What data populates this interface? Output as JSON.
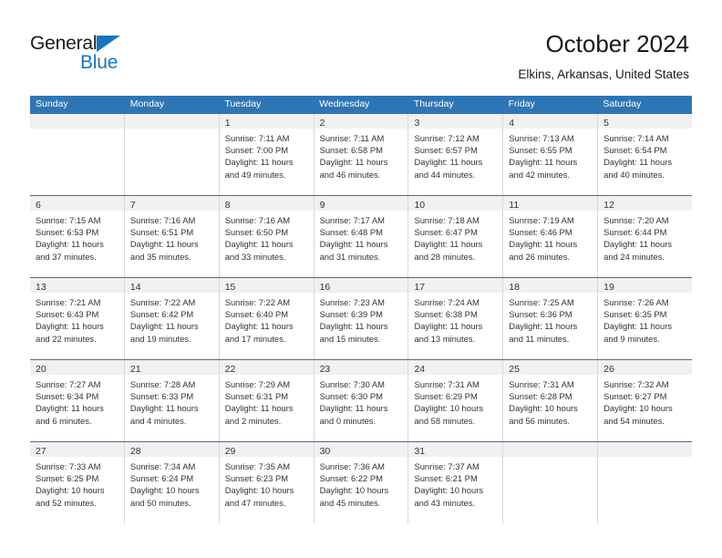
{
  "logo": {
    "word_one": "General",
    "word_two": "Blue",
    "triangle_color": "#1b75bb",
    "text_color": "#1a1a1a"
  },
  "header": {
    "title": "October 2024",
    "location": "Elkins, Arkansas, United States"
  },
  "theme": {
    "header_blue": "#2e75b6",
    "date_band_gray": "#f1f1f1",
    "cell_border": "#d8d8d8",
    "text": "#333333"
  },
  "weekdays": [
    "Sunday",
    "Monday",
    "Tuesday",
    "Wednesday",
    "Thursday",
    "Friday",
    "Saturday"
  ],
  "weeks": [
    [
      {
        "day": "",
        "sunrise": "",
        "sunset": "",
        "daylight_line1": "",
        "daylight_line2": ""
      },
      {
        "day": "",
        "sunrise": "",
        "sunset": "",
        "daylight_line1": "",
        "daylight_line2": ""
      },
      {
        "day": "1",
        "sunrise": "Sunrise: 7:11 AM",
        "sunset": "Sunset: 7:00 PM",
        "daylight_line1": "Daylight: 11 hours",
        "daylight_line2": "and 49 minutes."
      },
      {
        "day": "2",
        "sunrise": "Sunrise: 7:11 AM",
        "sunset": "Sunset: 6:58 PM",
        "daylight_line1": "Daylight: 11 hours",
        "daylight_line2": "and 46 minutes."
      },
      {
        "day": "3",
        "sunrise": "Sunrise: 7:12 AM",
        "sunset": "Sunset: 6:57 PM",
        "daylight_line1": "Daylight: 11 hours",
        "daylight_line2": "and 44 minutes."
      },
      {
        "day": "4",
        "sunrise": "Sunrise: 7:13 AM",
        "sunset": "Sunset: 6:55 PM",
        "daylight_line1": "Daylight: 11 hours",
        "daylight_line2": "and 42 minutes."
      },
      {
        "day": "5",
        "sunrise": "Sunrise: 7:14 AM",
        "sunset": "Sunset: 6:54 PM",
        "daylight_line1": "Daylight: 11 hours",
        "daylight_line2": "and 40 minutes."
      }
    ],
    [
      {
        "day": "6",
        "sunrise": "Sunrise: 7:15 AM",
        "sunset": "Sunset: 6:53 PM",
        "daylight_line1": "Daylight: 11 hours",
        "daylight_line2": "and 37 minutes."
      },
      {
        "day": "7",
        "sunrise": "Sunrise: 7:16 AM",
        "sunset": "Sunset: 6:51 PM",
        "daylight_line1": "Daylight: 11 hours",
        "daylight_line2": "and 35 minutes."
      },
      {
        "day": "8",
        "sunrise": "Sunrise: 7:16 AM",
        "sunset": "Sunset: 6:50 PM",
        "daylight_line1": "Daylight: 11 hours",
        "daylight_line2": "and 33 minutes."
      },
      {
        "day": "9",
        "sunrise": "Sunrise: 7:17 AM",
        "sunset": "Sunset: 6:48 PM",
        "daylight_line1": "Daylight: 11 hours",
        "daylight_line2": "and 31 minutes."
      },
      {
        "day": "10",
        "sunrise": "Sunrise: 7:18 AM",
        "sunset": "Sunset: 6:47 PM",
        "daylight_line1": "Daylight: 11 hours",
        "daylight_line2": "and 28 minutes."
      },
      {
        "day": "11",
        "sunrise": "Sunrise: 7:19 AM",
        "sunset": "Sunset: 6:46 PM",
        "daylight_line1": "Daylight: 11 hours",
        "daylight_line2": "and 26 minutes."
      },
      {
        "day": "12",
        "sunrise": "Sunrise: 7:20 AM",
        "sunset": "Sunset: 6:44 PM",
        "daylight_line1": "Daylight: 11 hours",
        "daylight_line2": "and 24 minutes."
      }
    ],
    [
      {
        "day": "13",
        "sunrise": "Sunrise: 7:21 AM",
        "sunset": "Sunset: 6:43 PM",
        "daylight_line1": "Daylight: 11 hours",
        "daylight_line2": "and 22 minutes."
      },
      {
        "day": "14",
        "sunrise": "Sunrise: 7:22 AM",
        "sunset": "Sunset: 6:42 PM",
        "daylight_line1": "Daylight: 11 hours",
        "daylight_line2": "and 19 minutes."
      },
      {
        "day": "15",
        "sunrise": "Sunrise: 7:22 AM",
        "sunset": "Sunset: 6:40 PM",
        "daylight_line1": "Daylight: 11 hours",
        "daylight_line2": "and 17 minutes."
      },
      {
        "day": "16",
        "sunrise": "Sunrise: 7:23 AM",
        "sunset": "Sunset: 6:39 PM",
        "daylight_line1": "Daylight: 11 hours",
        "daylight_line2": "and 15 minutes."
      },
      {
        "day": "17",
        "sunrise": "Sunrise: 7:24 AM",
        "sunset": "Sunset: 6:38 PM",
        "daylight_line1": "Daylight: 11 hours",
        "daylight_line2": "and 13 minutes."
      },
      {
        "day": "18",
        "sunrise": "Sunrise: 7:25 AM",
        "sunset": "Sunset: 6:36 PM",
        "daylight_line1": "Daylight: 11 hours",
        "daylight_line2": "and 11 minutes."
      },
      {
        "day": "19",
        "sunrise": "Sunrise: 7:26 AM",
        "sunset": "Sunset: 6:35 PM",
        "daylight_line1": "Daylight: 11 hours",
        "daylight_line2": "and 9 minutes."
      }
    ],
    [
      {
        "day": "20",
        "sunrise": "Sunrise: 7:27 AM",
        "sunset": "Sunset: 6:34 PM",
        "daylight_line1": "Daylight: 11 hours",
        "daylight_line2": "and 6 minutes."
      },
      {
        "day": "21",
        "sunrise": "Sunrise: 7:28 AM",
        "sunset": "Sunset: 6:33 PM",
        "daylight_line1": "Daylight: 11 hours",
        "daylight_line2": "and 4 minutes."
      },
      {
        "day": "22",
        "sunrise": "Sunrise: 7:29 AM",
        "sunset": "Sunset: 6:31 PM",
        "daylight_line1": "Daylight: 11 hours",
        "daylight_line2": "and 2 minutes."
      },
      {
        "day": "23",
        "sunrise": "Sunrise: 7:30 AM",
        "sunset": "Sunset: 6:30 PM",
        "daylight_line1": "Daylight: 11 hours",
        "daylight_line2": "and 0 minutes."
      },
      {
        "day": "24",
        "sunrise": "Sunrise: 7:31 AM",
        "sunset": "Sunset: 6:29 PM",
        "daylight_line1": "Daylight: 10 hours",
        "daylight_line2": "and 58 minutes."
      },
      {
        "day": "25",
        "sunrise": "Sunrise: 7:31 AM",
        "sunset": "Sunset: 6:28 PM",
        "daylight_line1": "Daylight: 10 hours",
        "daylight_line2": "and 56 minutes."
      },
      {
        "day": "26",
        "sunrise": "Sunrise: 7:32 AM",
        "sunset": "Sunset: 6:27 PM",
        "daylight_line1": "Daylight: 10 hours",
        "daylight_line2": "and 54 minutes."
      }
    ],
    [
      {
        "day": "27",
        "sunrise": "Sunrise: 7:33 AM",
        "sunset": "Sunset: 6:25 PM",
        "daylight_line1": "Daylight: 10 hours",
        "daylight_line2": "and 52 minutes."
      },
      {
        "day": "28",
        "sunrise": "Sunrise: 7:34 AM",
        "sunset": "Sunset: 6:24 PM",
        "daylight_line1": "Daylight: 10 hours",
        "daylight_line2": "and 50 minutes."
      },
      {
        "day": "29",
        "sunrise": "Sunrise: 7:35 AM",
        "sunset": "Sunset: 6:23 PM",
        "daylight_line1": "Daylight: 10 hours",
        "daylight_line2": "and 47 minutes."
      },
      {
        "day": "30",
        "sunrise": "Sunrise: 7:36 AM",
        "sunset": "Sunset: 6:22 PM",
        "daylight_line1": "Daylight: 10 hours",
        "daylight_line2": "and 45 minutes."
      },
      {
        "day": "31",
        "sunrise": "Sunrise: 7:37 AM",
        "sunset": "Sunset: 6:21 PM",
        "daylight_line1": "Daylight: 10 hours",
        "daylight_line2": "and 43 minutes."
      },
      {
        "day": "",
        "sunrise": "",
        "sunset": "",
        "daylight_line1": "",
        "daylight_line2": ""
      },
      {
        "day": "",
        "sunrise": "",
        "sunset": "",
        "daylight_line1": "",
        "daylight_line2": ""
      }
    ]
  ]
}
